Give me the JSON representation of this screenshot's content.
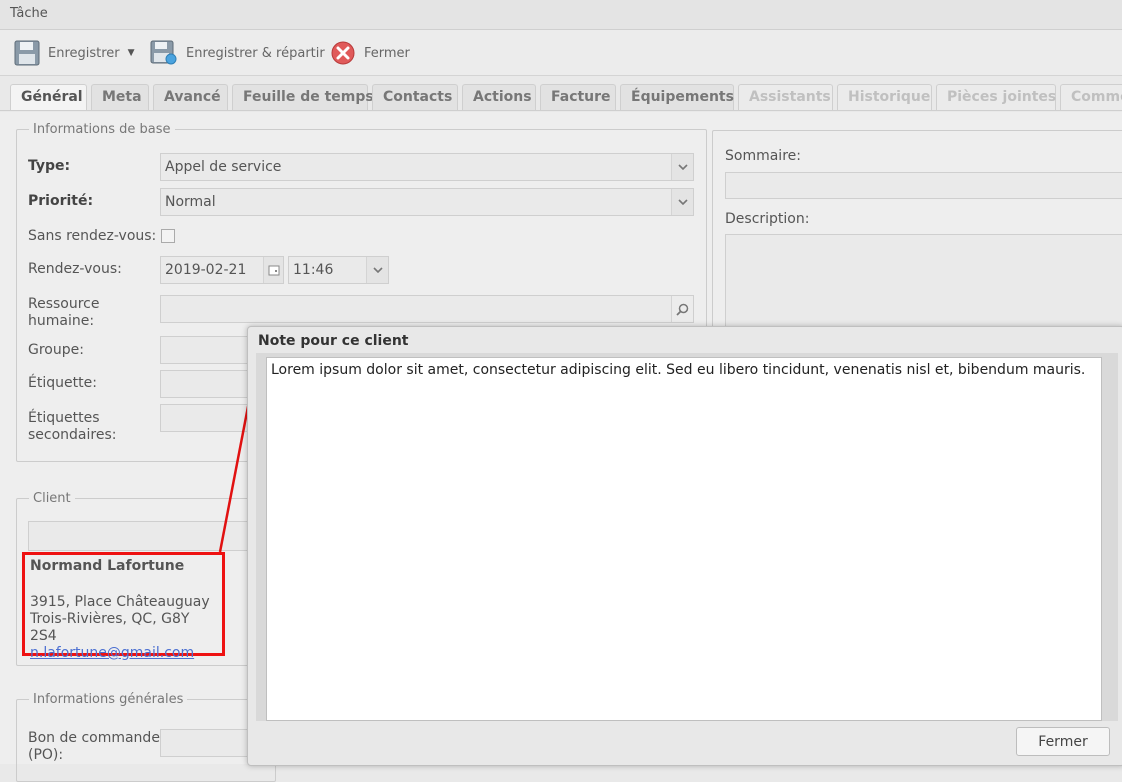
{
  "window": {
    "title": "Tâche"
  },
  "toolbar": {
    "save_label": "Enregistrer",
    "save_dispatch_label": "Enregistrer & répartir",
    "close_label": "Fermer"
  },
  "tabs": [
    {
      "label": "Général",
      "state": "active"
    },
    {
      "label": "Meta",
      "state": "enabled"
    },
    {
      "label": "Avancé",
      "state": "enabled"
    },
    {
      "label": "Feuille de temps",
      "state": "enabled"
    },
    {
      "label": "Contacts",
      "state": "enabled"
    },
    {
      "label": "Actions",
      "state": "enabled"
    },
    {
      "label": "Facture",
      "state": "enabled"
    },
    {
      "label": "Équipements",
      "state": "enabled"
    },
    {
      "label": "Assistants",
      "state": "disabled"
    },
    {
      "label": "Historique",
      "state": "disabled"
    },
    {
      "label": "Pièces jointes",
      "state": "disabled"
    },
    {
      "label": "Comme",
      "state": "disabled"
    }
  ],
  "basic_info": {
    "legend": "Informations de base",
    "type_label": "Type:",
    "type_value": "Appel de service",
    "priority_label": "Priorité:",
    "priority_value": "Normal",
    "no_appointment_label": "Sans rendez-vous:",
    "appointment_label": "Rendez-vous:",
    "appointment_date": "2019-02-21",
    "appointment_time": "11:46",
    "resource_label_1": "Ressource",
    "resource_label_2": "humaine:",
    "group_label": "Groupe:",
    "tag_label": "Étiquette:",
    "secondary_tags_label_1": "Étiquettes",
    "secondary_tags_label_2": "secondaires:"
  },
  "summary": {
    "summary_label": "Sommaire:",
    "description_label": "Description:"
  },
  "client": {
    "legend": "Client",
    "name": "Normand Lafortune",
    "address_line1": "3915, Place Châteauguay",
    "address_line2": "Trois-Rivières, QC, G8Y 2S4",
    "email": "n.lafortune@gmail.com"
  },
  "general_info": {
    "legend": "Informations générales",
    "po_label_1": "Bon de commande",
    "po_label_2": "(PO):"
  },
  "dialog": {
    "title": "Note pour ce client",
    "note": "Lorem ipsum dolor sit amet, consectetur adipiscing elit. Sed eu libero tincidunt, venenatis nisl et, bibendum mauris.",
    "close_label": "Fermer"
  },
  "colors": {
    "highlight_red": "#e11111",
    "link_blue": "#4b6fd1"
  }
}
